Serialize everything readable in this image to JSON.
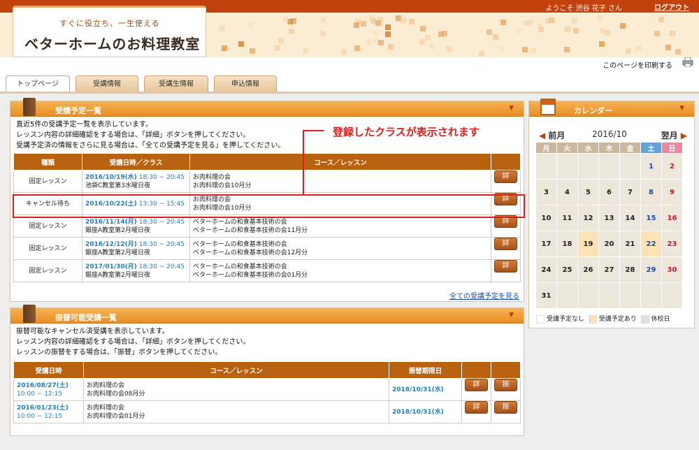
{
  "header": {
    "welcome": "ようこそ 渋谷 花子 さん",
    "logout": "ログアウト",
    "logo_sub": "すぐに役立ち、一生使える",
    "logo_main": "ベターホームのお料理教室",
    "print_label": "このページを印刷する"
  },
  "tabs": [
    {
      "label": "トップページ"
    },
    {
      "label": "受講情報"
    },
    {
      "label": "受講生情報"
    },
    {
      "label": "申込情報"
    }
  ],
  "schedule": {
    "title": "受講予定一覧",
    "intro": [
      "直近5件の受講予定一覧を表示しています。",
      "レッスン内容の詳細確認をする場合は、「詳細」ボタンを押してください。",
      "受講予定済の情報をさらに見る場合は、「全ての受講予定を見る」を押してください。"
    ],
    "headers": {
      "type": "種類",
      "date": "受講日時／クラス",
      "course": "コース／レッスン"
    },
    "rows": [
      {
        "type": "固定レッスン",
        "date": "2016/10/19(水)",
        "time": "18:30 − 20:45",
        "class": "池袋C教室第3水曜日夜",
        "course1": "お肉料理の会",
        "course2": "お肉料理の会10月分",
        "detail": "詳細"
      },
      {
        "type": "キャンセル待ち",
        "date": "2016/10/22(土)",
        "time": "13:30 − 15:45",
        "class": "",
        "course1": "お肉料理の会",
        "course2": "お肉料理の会10月分",
        "detail": "詳細"
      },
      {
        "type": "固定レッスン",
        "date": "2016/11/14(月)",
        "time": "18:30 − 20:45",
        "class": "銀座A教室第2月曜日夜",
        "course1": "ベターホームの和食基本技術の会",
        "course2": "ベターホームの和食基本技術の会11月分",
        "detail": "詳細"
      },
      {
        "type": "固定レッスン",
        "date": "2016/12/12(月)",
        "time": "18:30 − 20:45",
        "class": "銀座A教室第2月曜日夜",
        "course1": "ベターホームの和食基本技術の会",
        "course2": "ベターホームの和食基本技術の会12月分",
        "detail": "詳細"
      },
      {
        "type": "固定レッスン",
        "date": "2017/01/30(月)",
        "time": "18:30 − 20:45",
        "class": "銀座A教室第2月曜日夜",
        "course1": "ベターホームの和食基本技術の会",
        "course2": "ベターホームの和食基本技術の会01月分",
        "detail": "詳細"
      }
    ],
    "all_link": "全ての受講予定を見る"
  },
  "callout": "登録したクラスが表示されます",
  "transfer": {
    "title": "振替可能受講一覧",
    "intro": [
      "振替可能なキャンセル済受講を表示しています。",
      "レッスン内容の詳細確認をする場合は、「詳細」ボタンを押してください。",
      "レッスンの振替をする場合は、「振替」ボタンを押してください。"
    ],
    "headers": {
      "date": "受講日時",
      "course": "コース／レッスン",
      "deadline": "振替期限日"
    },
    "rows": [
      {
        "date": "2016/08/27(土)",
        "time": "10:00 − 12:15",
        "course1": "お肉料理の会",
        "course2": "お肉料理の会08月分",
        "deadline": "2018/10/31(水)",
        "detail": "詳細",
        "transfer": "振替"
      },
      {
        "date": "2016/01/23(土)",
        "time": "10:00 − 12:15",
        "course1": "お肉料理の会",
        "course2": "お肉料理の会01月分",
        "deadline": "2018/10/31(水)",
        "detail": "詳細",
        "transfer": "振替"
      }
    ]
  },
  "calendar": {
    "title": "カレンダー",
    "prev": "前月",
    "next": "翌月",
    "month": "2016/10",
    "weekdays": [
      "月",
      "火",
      "水",
      "木",
      "金",
      "土",
      "日"
    ],
    "weeks": [
      [
        "",
        "",
        "",
        "",
        "",
        "1",
        "2"
      ],
      [
        "3",
        "4",
        "5",
        "6",
        "7",
        "8",
        "9"
      ],
      [
        "10",
        "11",
        "12",
        "13",
        "14",
        "15",
        "16"
      ],
      [
        "17",
        "18",
        "19",
        "20",
        "21",
        "22",
        "23"
      ],
      [
        "24",
        "25",
        "26",
        "27",
        "28",
        "29",
        "30"
      ],
      [
        "31",
        "",
        "",
        "",
        "",
        "",
        ""
      ]
    ],
    "highlight_days": [
      "19",
      "22"
    ],
    "legend": [
      "受講予定なし",
      "受講予定あり",
      "休校日"
    ]
  }
}
